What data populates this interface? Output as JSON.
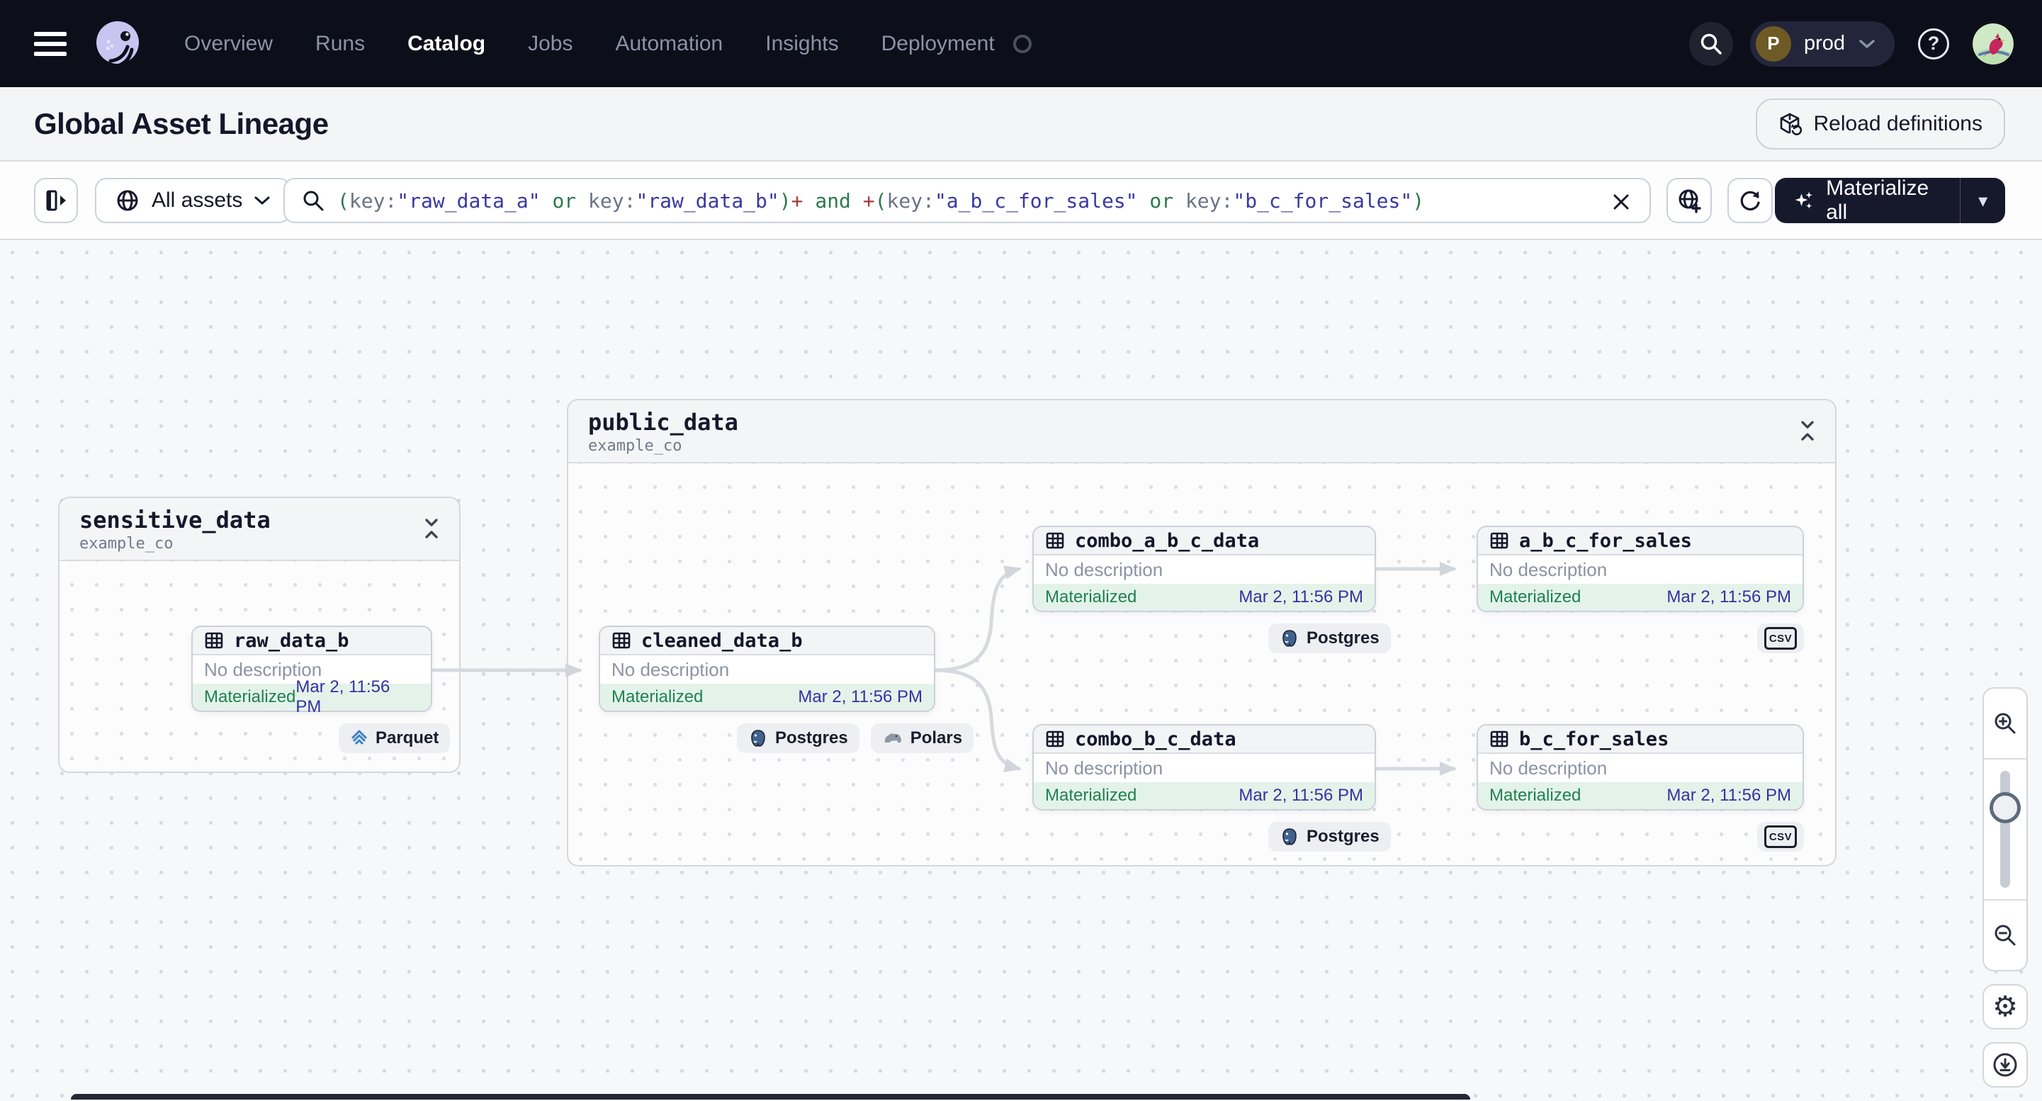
{
  "colors": {
    "nav_bg": "#0c0e19",
    "accent_dark": "#16182c",
    "query_green": "#2c7a4b",
    "query_indigo": "#3a38a0",
    "query_slate": "#6a7385",
    "query_red": "#9c3c38",
    "status_green_bg": "#e4f3ea",
    "status_green_text": "#1f8150",
    "date_text": "#3431a1",
    "edge": "#d6d9de",
    "env_avatar_bg": "#6e5a25",
    "logo_lavender": "#c9c5f1"
  },
  "nav": {
    "items": [
      {
        "label": "Overview"
      },
      {
        "label": "Runs"
      },
      {
        "label": "Catalog",
        "active": true
      },
      {
        "label": "Jobs"
      },
      {
        "label": "Automation"
      },
      {
        "label": "Insights"
      },
      {
        "label": "Deployment"
      }
    ],
    "env": {
      "initial": "P",
      "name": "prod"
    }
  },
  "header": {
    "title": "Global Asset Lineage",
    "reload_button": "Reload definitions"
  },
  "toolbar": {
    "asset_filter": "All assets",
    "materialize": "Materialize all",
    "query_tokens": [
      {
        "t": "(",
        "c": "green"
      },
      {
        "t": "key:",
        "c": "slate"
      },
      {
        "t": "\"raw_data_a\"",
        "c": "indigo"
      },
      {
        "t": " ",
        "c": "plain"
      },
      {
        "t": "or",
        "c": "green"
      },
      {
        "t": " ",
        "c": "plain"
      },
      {
        "t": "key:",
        "c": "slate"
      },
      {
        "t": "\"raw_data_b\"",
        "c": "indigo"
      },
      {
        "t": ")",
        "c": "green"
      },
      {
        "t": "+",
        "c": "red"
      },
      {
        "t": " ",
        "c": "plain"
      },
      {
        "t": "and",
        "c": "green"
      },
      {
        "t": " ",
        "c": "plain"
      },
      {
        "t": "+",
        "c": "red"
      },
      {
        "t": "(",
        "c": "green"
      },
      {
        "t": "key:",
        "c": "slate"
      },
      {
        "t": "\"a_b_c_for_sales\"",
        "c": "indigo"
      },
      {
        "t": " ",
        "c": "plain"
      },
      {
        "t": "or",
        "c": "green"
      },
      {
        "t": " ",
        "c": "plain"
      },
      {
        "t": "key:",
        "c": "slate"
      },
      {
        "t": "\"b_c_for_sales\"",
        "c": "indigo"
      },
      {
        "t": ")",
        "c": "green"
      }
    ]
  },
  "icons": {
    "help_glyph": "?",
    "gear_glyph": "⚙",
    "caret_glyph": "▾"
  },
  "graph": {
    "groups": [
      {
        "name": "sensitive_data",
        "subtitle": "example_co"
      },
      {
        "name": "public_data",
        "subtitle": "example_co"
      }
    ],
    "nodes": [
      {
        "name": "raw_data_b",
        "desc": "No description",
        "status": "Materialized",
        "date": "Mar 2, 11:56 PM",
        "badges": [
          {
            "label": "Parquet",
            "icon": "parquet-icon"
          }
        ]
      },
      {
        "name": "cleaned_data_b",
        "desc": "No description",
        "status": "Materialized",
        "date": "Mar 2, 11:56 PM",
        "badges": [
          {
            "label": "Postgres",
            "icon": "postgres-icon"
          },
          {
            "label": "Polars",
            "icon": "polars-icon"
          }
        ]
      },
      {
        "name": "combo_a_b_c_data",
        "desc": "No description",
        "status": "Materialized",
        "date": "Mar 2, 11:56 PM",
        "badges": [
          {
            "label": "Postgres",
            "icon": "postgres-icon"
          }
        ]
      },
      {
        "name": "a_b_c_for_sales",
        "desc": "No description",
        "status": "Materialized",
        "date": "Mar 2, 11:56 PM",
        "badges": [
          {
            "label": "CSV",
            "icon": "csv-icon"
          }
        ]
      },
      {
        "name": "combo_b_c_data",
        "desc": "No description",
        "status": "Materialized",
        "date": "Mar 2, 11:56 PM",
        "badges": [
          {
            "label": "Postgres",
            "icon": "postgres-icon"
          }
        ]
      },
      {
        "name": "b_c_for_sales",
        "desc": "No description",
        "status": "Materialized",
        "date": "Mar 2, 11:56 PM",
        "badges": [
          {
            "label": "CSV",
            "icon": "csv-icon"
          }
        ]
      }
    ]
  }
}
